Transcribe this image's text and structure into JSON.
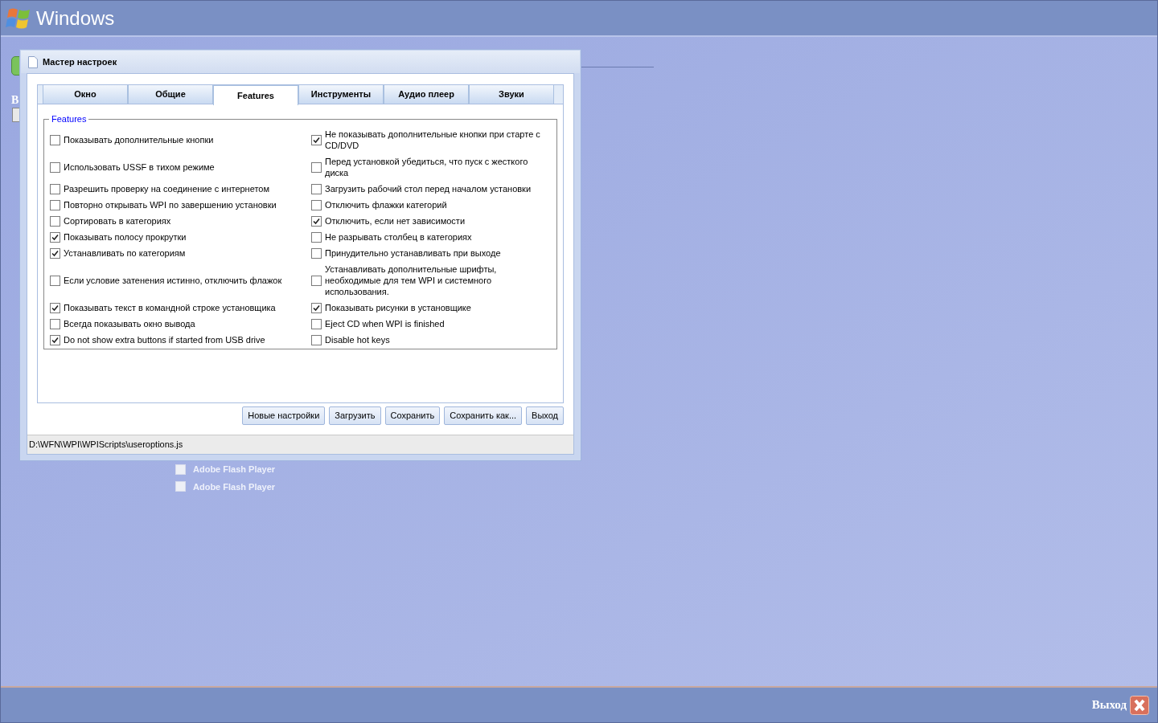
{
  "desktop": {
    "title": "Windows",
    "behind_label": "В",
    "background_items": [
      {
        "label": "Adobe Flash Player",
        "checked": false
      },
      {
        "label": "Adobe Flash Player",
        "checked": false
      }
    ],
    "exit_label": "Выход"
  },
  "dialog": {
    "title": "Мастер настроек",
    "tabs": [
      {
        "label": "Окно",
        "selected": false
      },
      {
        "label": "Общие",
        "selected": false
      },
      {
        "label": "Features",
        "selected": true
      },
      {
        "label": "Инструменты",
        "selected": false
      },
      {
        "label": "Аудио плеер",
        "selected": false
      },
      {
        "label": "Звуки",
        "selected": false
      }
    ],
    "group": {
      "title": "Features",
      "columns": [
        [
          {
            "label": "Показывать дополнительные кнопки",
            "checked": false
          },
          {
            "label": "Использовать USSF в тихом режиме",
            "checked": false
          },
          {
            "label": "Разрешить проверку на соединение с интернетом",
            "checked": false
          },
          {
            "label": "Повторно открывать WPI по завершению установки",
            "checked": false
          },
          {
            "label": "Сортировать в категориях",
            "checked": false
          },
          {
            "label": "Показывать полосу прокрутки",
            "checked": true
          },
          {
            "label": "Устанавливать по категориям",
            "checked": true
          },
          {
            "label": "Если условие затенения истинно, отключить флажок",
            "checked": false
          },
          {
            "label": "Показывать текст в командной строке установщика",
            "checked": true
          },
          {
            "label": "Всегда показывать окно вывода",
            "checked": false
          },
          {
            "label": "Do not show extra buttons if started from USB drive",
            "checked": true
          }
        ],
        [
          {
            "label": "Не показывать дополнительные кнопки при старте с CD/DVD",
            "checked": true
          },
          {
            "label": "Перед установкой убедиться, что пуск с жесткого диска",
            "checked": false
          },
          {
            "label": "Загрузить рабочий стол перед началом установки",
            "checked": false
          },
          {
            "label": "Отключить флажки категорий",
            "checked": false
          },
          {
            "label": "Отключить, если нет зависимости",
            "checked": true
          },
          {
            "label": "Не разрывать столбец в категориях",
            "checked": false
          },
          {
            "label": "Принудительно устанавливать при выходе",
            "checked": false
          },
          {
            "label": "Устанавливать дополнительные шрифты, необходимые для тем WPI и системного использования.",
            "checked": false
          },
          {
            "label": "Показывать рисунки в установщике",
            "checked": true
          },
          {
            "label": "Eject CD when WPI is finished",
            "checked": false
          },
          {
            "label": "Disable hot keys",
            "checked": false
          }
        ]
      ]
    },
    "buttons": [
      "Новые настройки",
      "Загрузить",
      "Сохранить",
      "Сохранить как...",
      "Выход"
    ],
    "status_bar": "D:\\WFN\\WPI\\WPIScripts\\useroptions.js"
  }
}
